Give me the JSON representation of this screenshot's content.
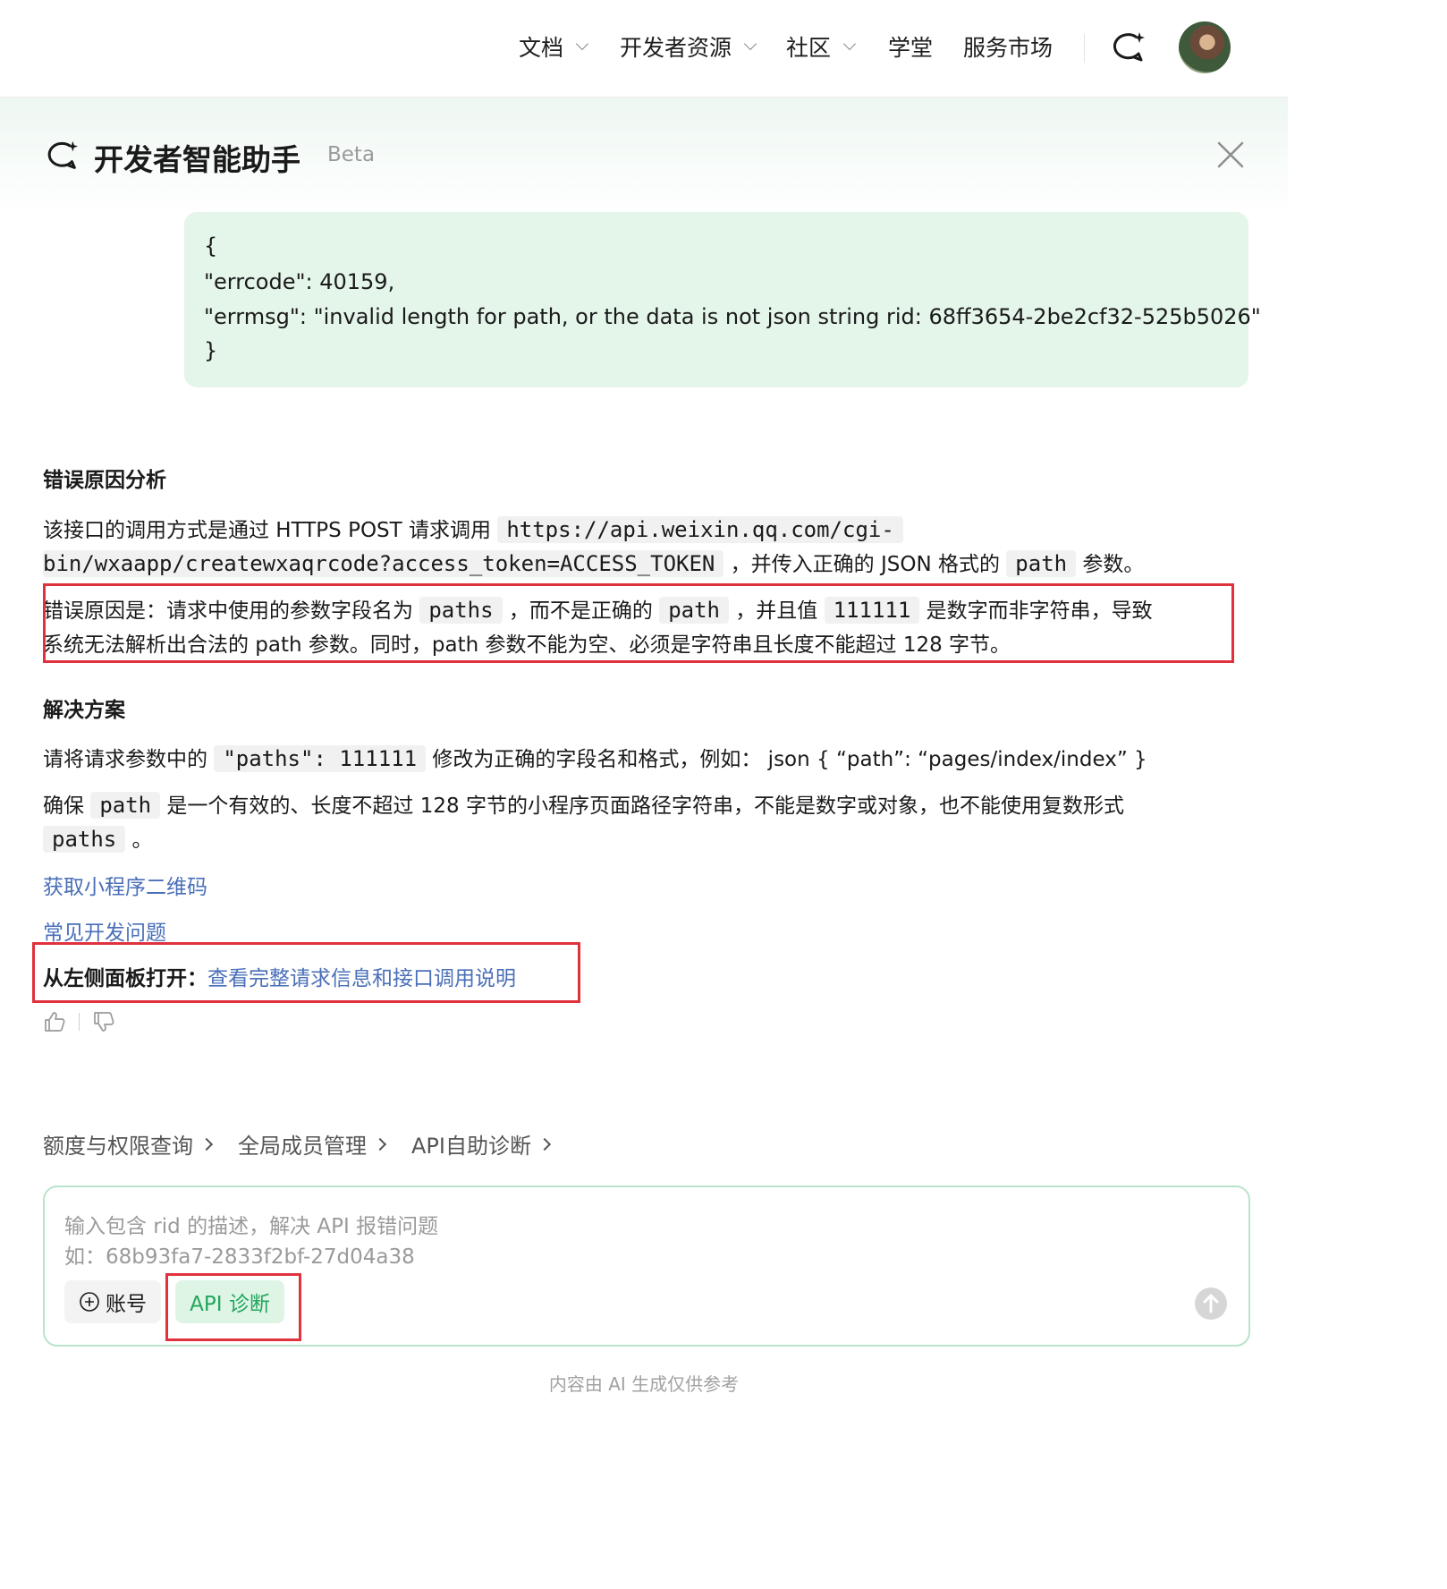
{
  "nav": {
    "items": [
      {
        "label": "文档",
        "has_menu": true
      },
      {
        "label": "开发者资源",
        "has_menu": true
      },
      {
        "label": "社区",
        "has_menu": true
      },
      {
        "label": "学堂",
        "has_menu": false
      },
      {
        "label": "服务市场",
        "has_menu": false
      }
    ],
    "icons": [
      "chat-sparkle-icon",
      "avatar"
    ]
  },
  "panel": {
    "title": "开发者智能助手",
    "badge": "Beta",
    "user_message": {
      "lines": [
        "{",
        "\"errcode\": 40159,",
        "\"errmsg\": \"invalid length for path, or the data is not json string rid: 68ff3654-2be2cf32-525b5026\"",
        "}"
      ]
    },
    "answer": {
      "heading1": "错误原因分析",
      "p1_a": "该接口的调用方式是通过 HTTPS POST 请求调用 ",
      "p1_code1": "https://api.weixin.qq.com/cgi-",
      "p1_code2": "bin/wxaapp/createwxaqrcode?access_token=ACCESS_TOKEN",
      "p1_b": " ，并传入正确的 JSON 格式的 ",
      "p1_code3": "path",
      "p1_c": " 参数。",
      "p2_a": "错误原因是：请求中使用的参数字段名为 ",
      "p2_code1": "paths",
      "p2_b": " ，而不是正确的 ",
      "p2_code2": "path",
      "p2_c": " ，并且值 ",
      "p2_code3": "111111",
      "p2_d": " 是数字而非字符串，导致",
      "p2_line2": "系统无法解析出合法的 path 参数。同时，path 参数不能为空、必须是字符串且长度不能超过 128 字节。",
      "heading2": "解决方案",
      "p3_a": "请将请求参数中的 ",
      "p3_code": "\"paths\": 111111",
      "p3_b": " 修改为正确的字段名和格式，例如： json { “path”: “pages/index/index” }",
      "p4_a": "确保 ",
      "p4_code1": "path",
      "p4_b": " 是一个有效的、长度不超过 128 字节的小程序页面路径字符串，不能是数字或对象，也不能使用复数形式",
      "p4_code2": "paths",
      "p4_c": " 。",
      "link1": "获取小程序二维码",
      "link2": "常见开发问题",
      "open_label": "从左侧面板打开：",
      "open_link": "查看完整请求信息和接口调用说明"
    },
    "quick_links": [
      "额度与权限查询",
      "全局成员管理",
      "API自助诊断"
    ],
    "input": {
      "placeholder_line1": "输入包含 rid 的描述，解决 API 报错问题",
      "placeholder_line2": "如：68b93fa7-2833f2bf-27d04a38",
      "account_button": "账号",
      "api_button": "API 诊断"
    },
    "footnote": "内容由 AI 生成仅供参考"
  },
  "colors": {
    "accent_green": "#22a55c",
    "link_blue": "#4a6fb8",
    "highlight_red": "#e0323c",
    "bubble_bg": "#e4f5ea"
  }
}
